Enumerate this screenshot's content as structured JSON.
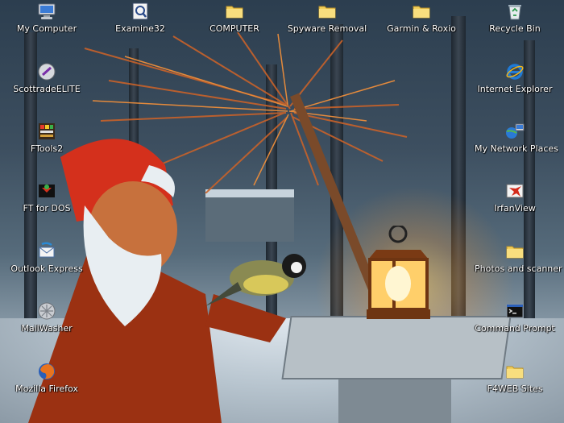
{
  "desktop": {
    "icons": [
      {
        "label": "My Computer",
        "icon": "my-computer-icon"
      },
      {
        "label": "Examine32",
        "icon": "examine32-icon"
      },
      {
        "label": "COMPUTER",
        "icon": "folder-icon"
      },
      {
        "label": "Spyware Removal",
        "icon": "folder-icon"
      },
      {
        "label": "Garmin & Roxio",
        "icon": "folder-icon"
      },
      {
        "label": "Recycle Bin",
        "icon": "recycle-bin-icon"
      },
      {
        "label": "ScottradeELITE",
        "icon": "scottrade-icon"
      },
      {
        "label": "Internet Explorer",
        "icon": "internet-explorer-icon"
      },
      {
        "label": "FTools2",
        "icon": "ftools-icon"
      },
      {
        "label": "My Network Places",
        "icon": "network-places-icon"
      },
      {
        "label": "FT for DOS",
        "icon": "ft-dos-icon"
      },
      {
        "label": "IrfanView",
        "icon": "irfanview-icon"
      },
      {
        "label": "Outlook Express",
        "icon": "outlook-express-icon"
      },
      {
        "label": "Photos and scanner",
        "icon": "folder-icon"
      },
      {
        "label": "MailWasher",
        "icon": "mailwasher-icon"
      },
      {
        "label": "Command Prompt",
        "icon": "command-prompt-icon"
      },
      {
        "label": "Mozilla Firefox",
        "icon": "firefox-icon"
      },
      {
        "label": "F4WEB Sites",
        "icon": "folder-icon"
      }
    ]
  }
}
